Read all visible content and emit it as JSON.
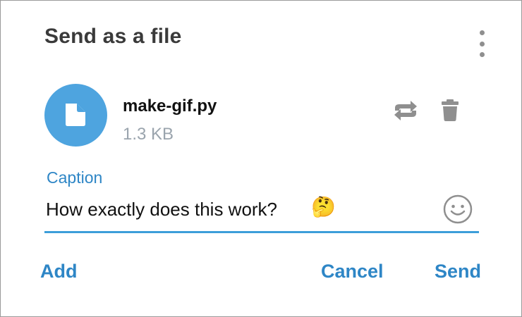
{
  "dialog": {
    "title": "Send as a file",
    "menu_icon": "more-vertical-icon"
  },
  "file": {
    "name": "make-gif.py",
    "size": "1.3 KB",
    "thumb_icon": "document-icon",
    "thumb_color": "#4ea4df"
  },
  "file_actions": {
    "replace_icon": "replace-icon",
    "delete_icon": "trash-icon"
  },
  "caption": {
    "label": "Caption",
    "value": "How exactly does this work?",
    "emoji": "🤔",
    "placeholder": "Caption",
    "emoji_picker_icon": "smiley-icon",
    "accent_color": "#3d9ed9"
  },
  "actions": {
    "add_label": "Add",
    "cancel_label": "Cancel",
    "send_label": "Send"
  }
}
